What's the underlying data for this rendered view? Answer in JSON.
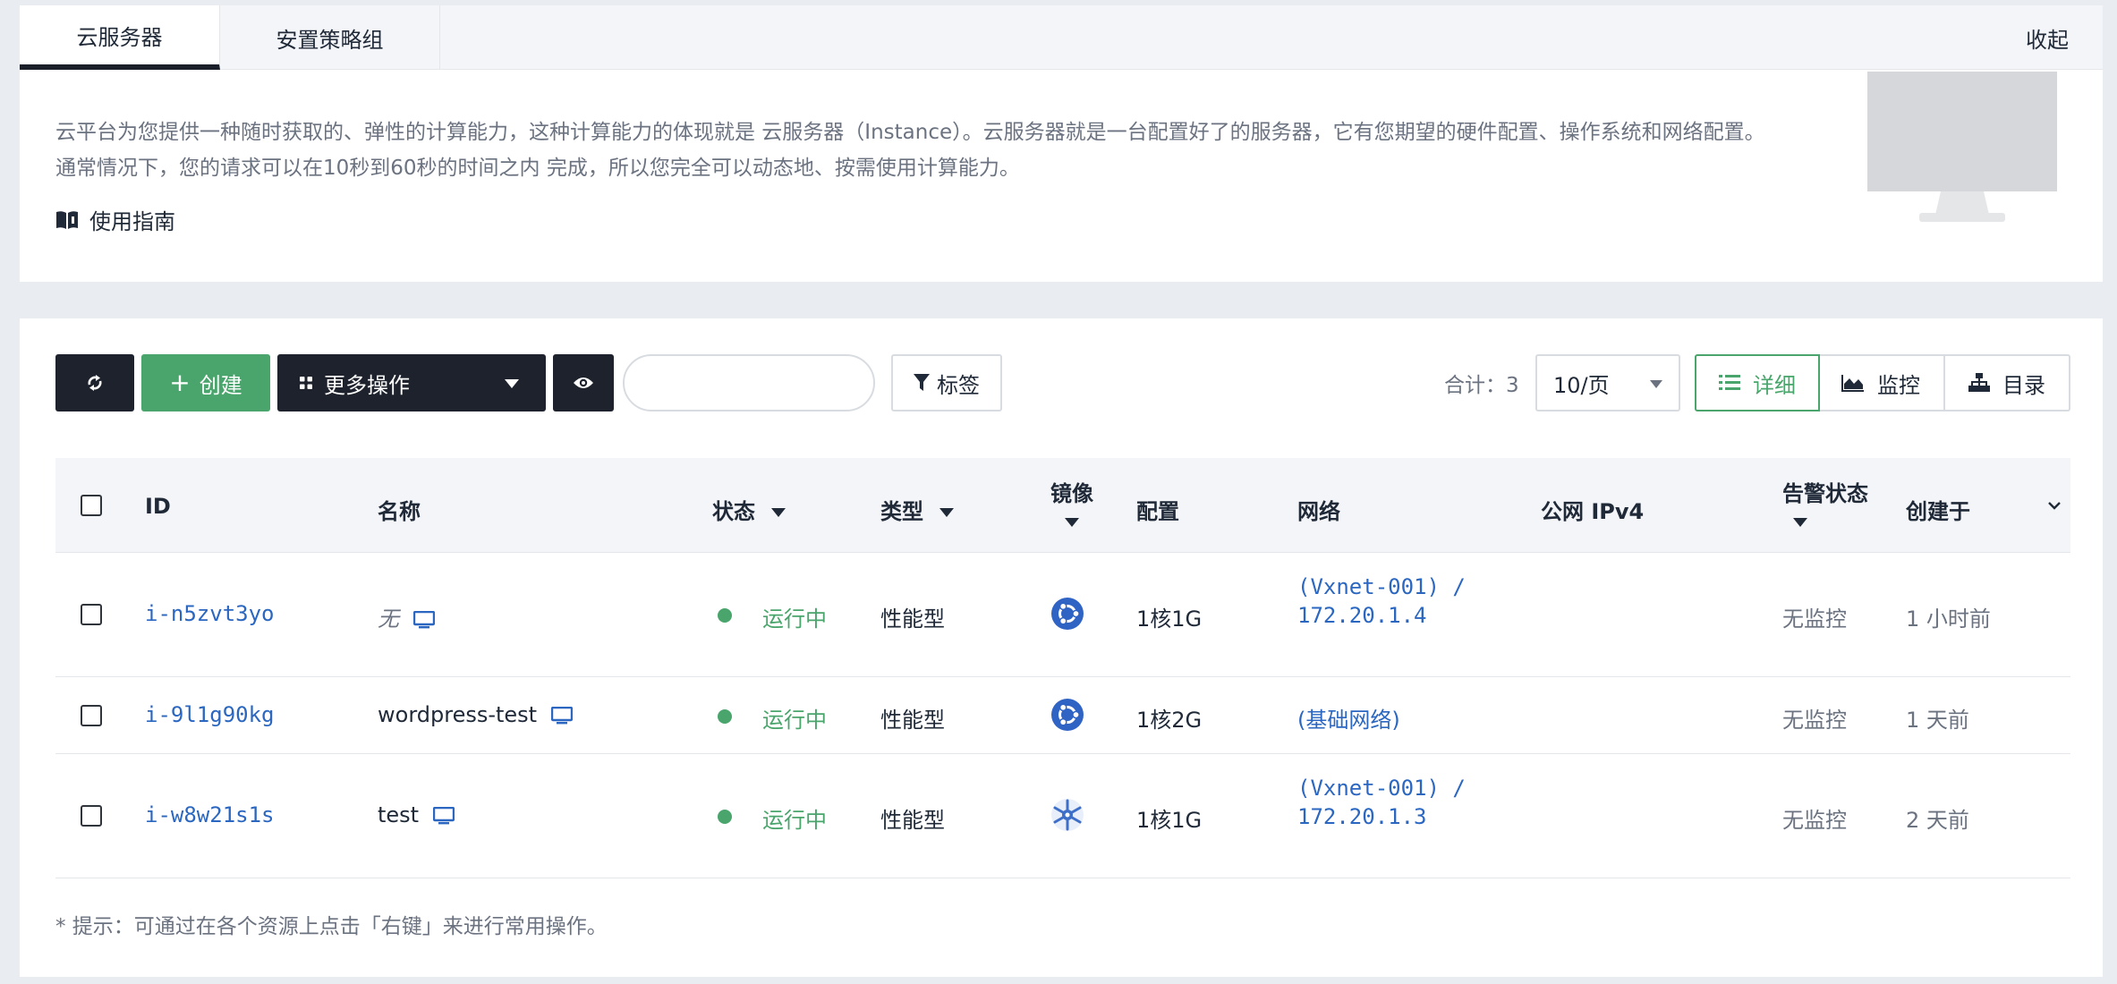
{
  "tabs": {
    "instances": "云服务器",
    "placement_groups": "安置策略组",
    "collapse": "收起"
  },
  "intro": {
    "text": "云平台为您提供一种随时获取的、弹性的计算能力，这种计算能力的体现就是 云服务器（Instance）。云服务器就是一台配置好了的服务器，它有您期望的硬件配置、操作系统和网络配置。通常情况下，您的请求可以在10秒到60秒的时间之内 完成，所以您完全可以动态地、按需使用计算能力。",
    "guide": "使用指南"
  },
  "toolbar": {
    "create": "创建",
    "more_actions": "更多操作",
    "search_value": "",
    "tag": "标签",
    "total": "合计：3",
    "page_size": "10/页",
    "view_detail": "详细",
    "view_monitor": "监控",
    "view_catalog": "目录"
  },
  "table": {
    "headers": {
      "id": "ID",
      "name": "名称",
      "status": "状态",
      "type": "类型",
      "image": "镜像",
      "config": "配置",
      "network": "网络",
      "public_ipv4": "公网 IPv4",
      "alarm": "告警状态",
      "created": "创建于"
    },
    "rows": [
      {
        "id": "i-n5zvt3yo",
        "name": "无",
        "status": "运行中",
        "type": "性能型",
        "image_icon": "ubuntu-icon",
        "config": "1核1G",
        "network_line1": "(Vxnet-001) /",
        "network_line2": "172.20.1.4",
        "public_ipv4": "",
        "alarm": "无监控",
        "created": "1 小时前"
      },
      {
        "id": "i-9l1g90kg",
        "name": "wordpress-test",
        "status": "运行中",
        "type": "性能型",
        "image_icon": "ubuntu-icon",
        "config": "1核2G",
        "network_line1": "(基础网络)",
        "network_line2": "",
        "public_ipv4": "",
        "alarm": "无监控",
        "created": "1 天前"
      },
      {
        "id": "i-w8w21s1s",
        "name": "test",
        "status": "运行中",
        "type": "性能型",
        "image_icon": "snowflake-os-icon",
        "config": "1核1G",
        "network_line1": "(Vxnet-001) /",
        "network_line2": "172.20.1.3",
        "public_ipv4": "",
        "alarm": "无监控",
        "created": "2 天前"
      }
    ]
  },
  "tip": "* 提示：可通过在各个资源上点击「右键」来进行常用操作。",
  "colors": {
    "accent_green": "#4aa56c",
    "link_blue": "#2b67c0",
    "dark_button": "#1d222c"
  }
}
